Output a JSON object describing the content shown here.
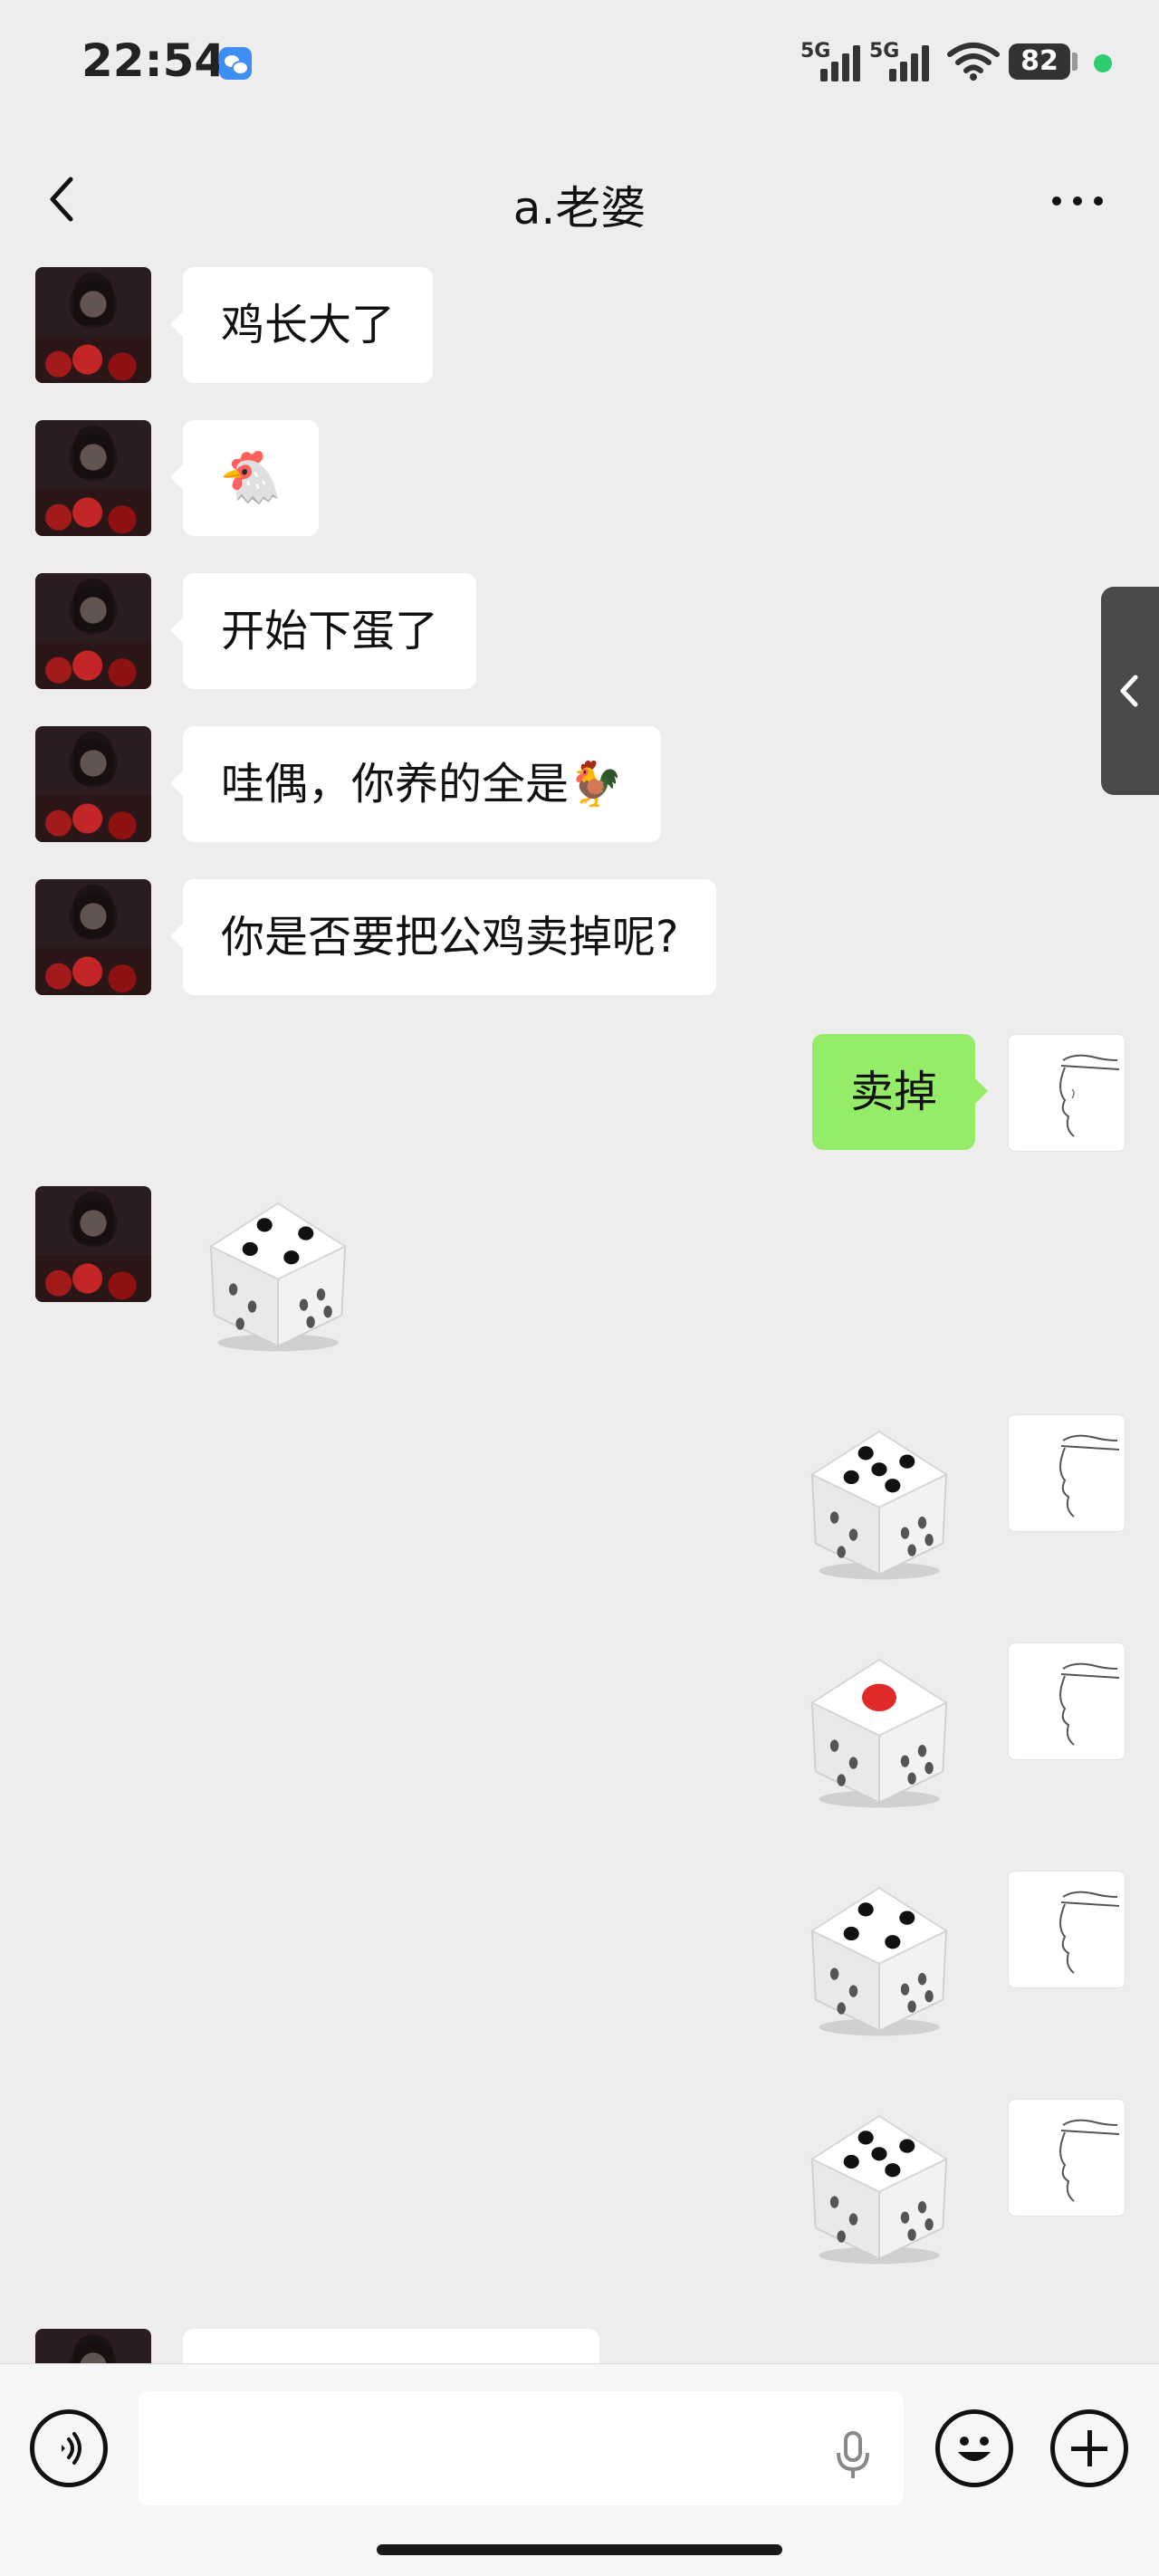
{
  "status_bar": {
    "time": "22:54",
    "signal_1_label": "5G",
    "signal_2_label": "5G",
    "battery": "82"
  },
  "nav": {
    "title": "a.老婆"
  },
  "messages": [
    {
      "from": "her",
      "type": "text",
      "text": "鸡长大了"
    },
    {
      "from": "her",
      "type": "emoji",
      "text": "🐔"
    },
    {
      "from": "her",
      "type": "text",
      "text": "开始下蛋了"
    },
    {
      "from": "her",
      "type": "text",
      "text": "哇偶，你养的全是🐓"
    },
    {
      "from": "her",
      "type": "text",
      "text": "你是否要把公鸡卖掉呢?"
    },
    {
      "from": "me",
      "type": "text",
      "text": "卖掉"
    },
    {
      "from": "her",
      "type": "dice",
      "value": 4
    },
    {
      "from": "me",
      "type": "dice",
      "value": 5
    },
    {
      "from": "me",
      "type": "dice",
      "value": 1
    },
    {
      "from": "me",
      "type": "dice",
      "value": 4
    },
    {
      "from": "me",
      "type": "dice",
      "value": 5
    }
  ],
  "input": {
    "placeholder": ""
  },
  "icons": {
    "back": "chevron-left-icon",
    "more": "more-dots-icon",
    "voice": "voice-icon",
    "mic": "mic-icon",
    "emoji": "emoji-icon",
    "plus": "plus-icon",
    "side_handle": "chevron-left-icon"
  },
  "colors": {
    "background": "#ededed",
    "my_bubble": "#95ec69",
    "their_bubble": "#ffffff",
    "dice_pip": "#111111",
    "dice_one_pip": "#e02a2a"
  }
}
